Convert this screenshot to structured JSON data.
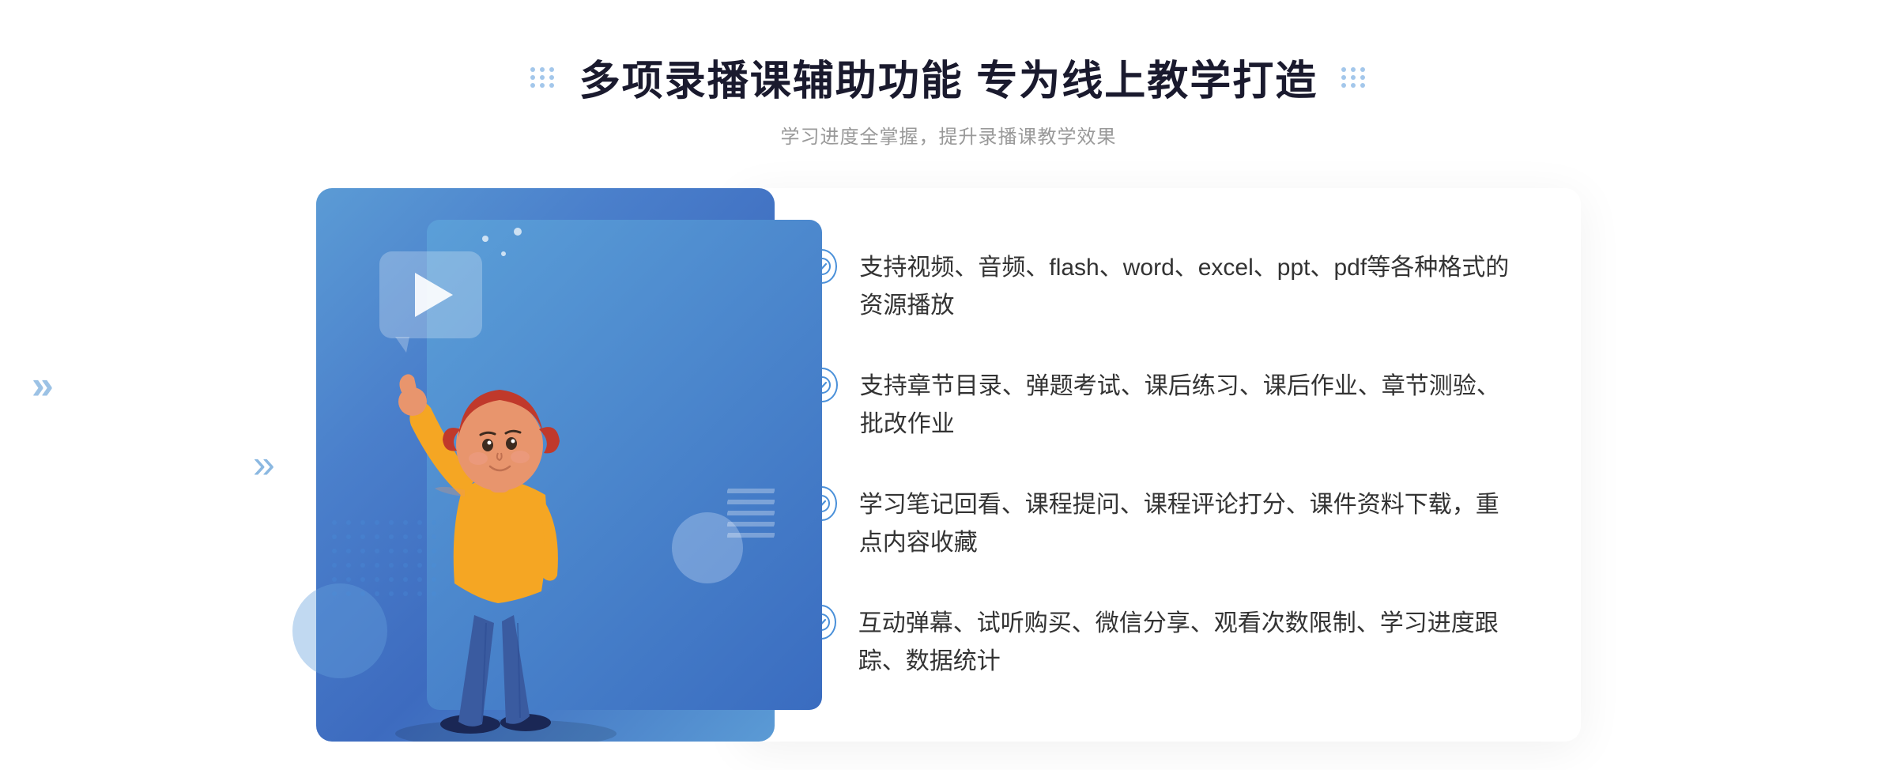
{
  "page": {
    "background_color": "#ffffff"
  },
  "header": {
    "title": "多项录播课辅助功能 专为线上教学打造",
    "subtitle": "学习进度全掌握，提升录播课教学效果"
  },
  "features": [
    {
      "id": 1,
      "text": "支持视频、音频、flash、word、excel、ppt、pdf等各种格式的资源播放"
    },
    {
      "id": 2,
      "text": "支持章节目录、弹题考试、课后练习、课后作业、章节测验、批改作业"
    },
    {
      "id": 3,
      "text": "学习笔记回看、课程提问、课程评论打分、课件资料下载，重点内容收藏"
    },
    {
      "id": 4,
      "text": "互动弹幕、试听购买、微信分享、观看次数限制、学习进度跟踪、数据统计"
    }
  ],
  "colors": {
    "primary_blue": "#4a90d9",
    "dark_blue": "#3d6bbf",
    "text_dark": "#1a1a2e",
    "text_gray": "#999999",
    "text_body": "#333333"
  }
}
